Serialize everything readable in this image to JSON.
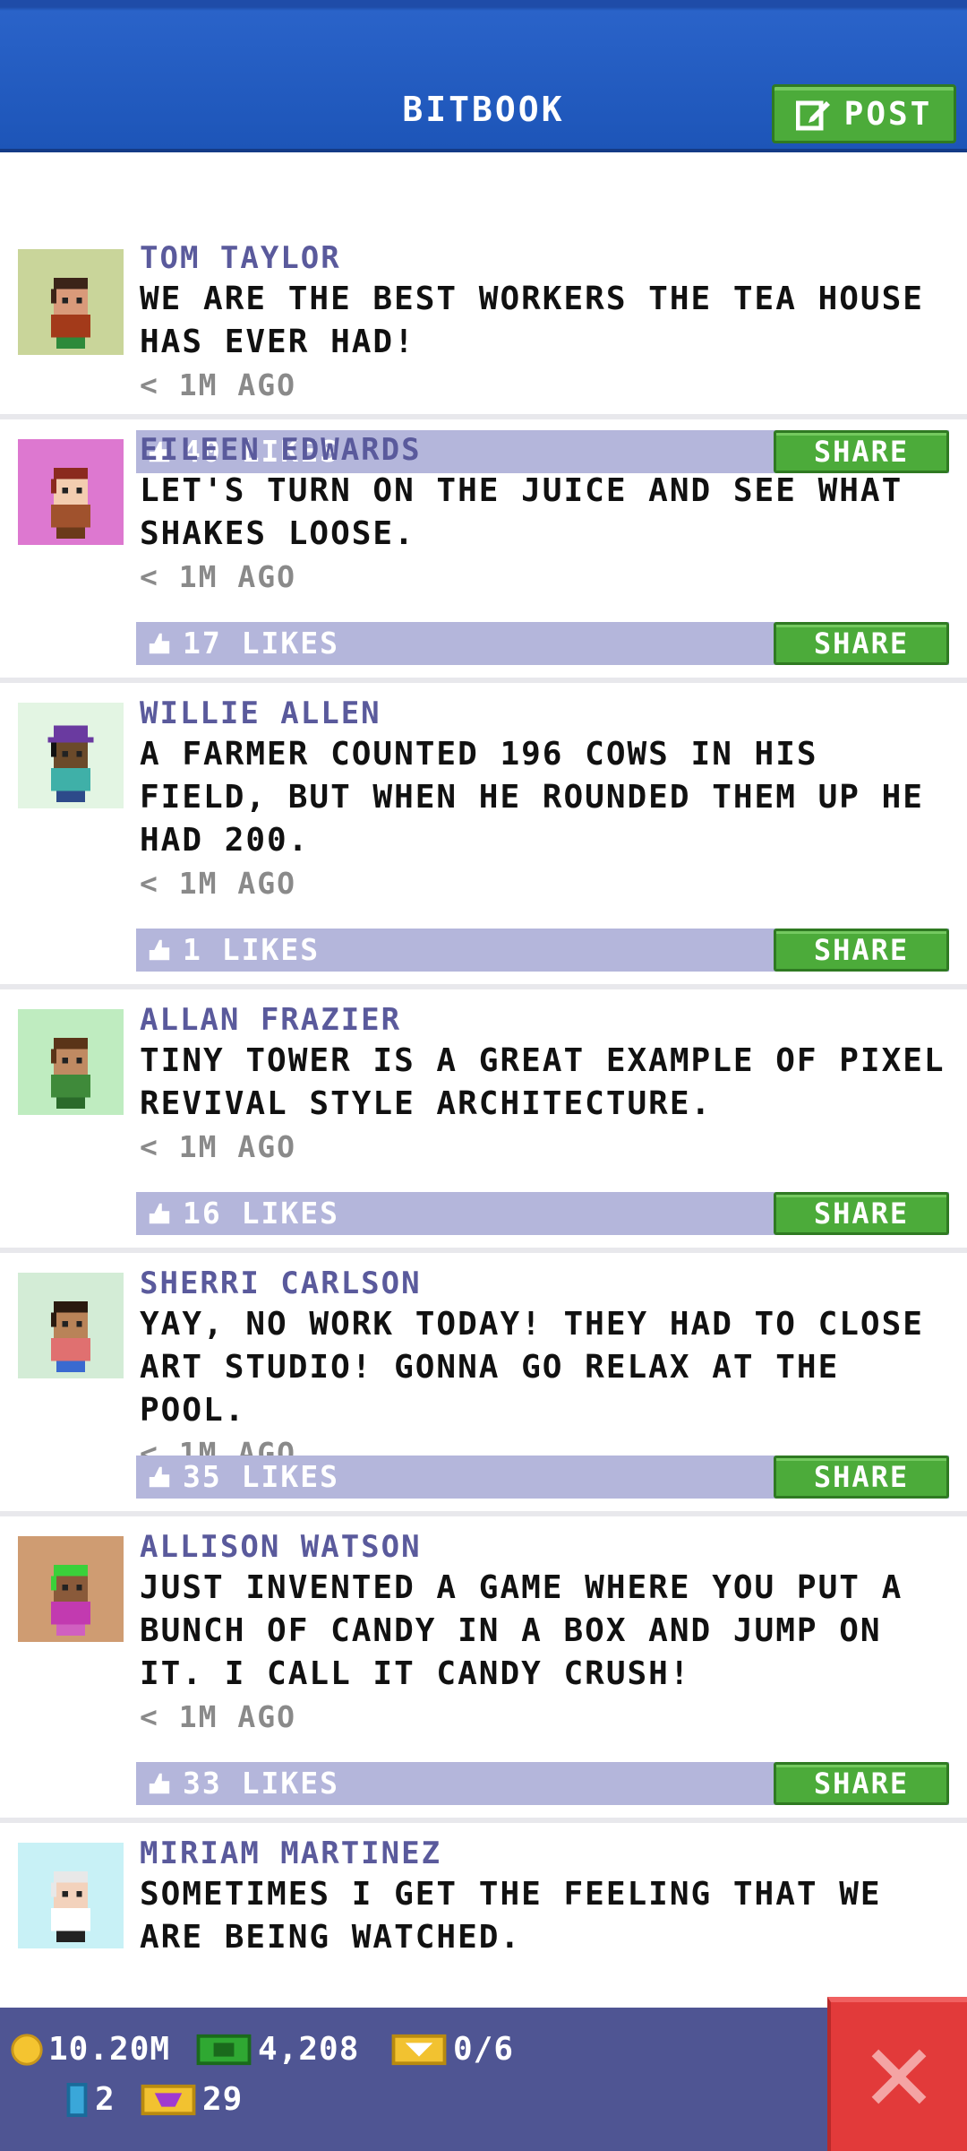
{
  "header": {
    "title": "BITBOOK",
    "post_label": "POST"
  },
  "posts": [
    {
      "name": "TOM TAYLOR",
      "message": "WE ARE THE BEST WORKERS THE TEA HOUSE HAS EVER HAD!",
      "time": "< 1M AGO",
      "likes": "40 LIKES",
      "share": "SHARE",
      "avatar_bg": "#c9d59a",
      "skin": "#d99a7a",
      "hair": "#3b2418",
      "shirt": "#a33a1a",
      "pants": "#2d8a3a",
      "hat": ""
    },
    {
      "name": "EILEEN EDWARDS",
      "message": "LET'S TURN ON THE JUICE AND SEE WHAT SHAKES LOOSE.",
      "time": "< 1M AGO",
      "likes": "17 LIKES",
      "share": "SHARE",
      "avatar_bg": "#dd78d0",
      "skin": "#f3cdb0",
      "hair": "#8b2a1e",
      "shirt": "#a0522d",
      "pants": "#6b3a1a",
      "hat": ""
    },
    {
      "name": "WILLIE ALLEN",
      "message": "A FARMER COUNTED 196 COWS IN HIS FIELD, BUT WHEN HE ROUNDED THEM UP HE HAD 200.",
      "time": "< 1M AGO",
      "likes": "1 LIKES",
      "share": "SHARE",
      "avatar_bg": "#e3f5e3",
      "skin": "#6b4a2a",
      "hair": "#111111",
      "shirt": "#3fb0a8",
      "pants": "#2d4a8a",
      "hat": "#6a3aa0"
    },
    {
      "name": "ALLAN FRAZIER",
      "message": "TINY TOWER IS A GREAT EXAMPLE OF PIXEL REVIVAL STYLE ARCHITECTURE.",
      "time": "< 1M AGO",
      "likes": "16 LIKES",
      "share": "SHARE",
      "avatar_bg": "#bfecc0",
      "skin": "#c08a62",
      "hair": "#5a3418",
      "shirt": "#3f8a3a",
      "pants": "#2a6a2a",
      "hat": ""
    },
    {
      "name": "SHERRI CARLSON",
      "message": "YAY, NO WORK TODAY! THEY HAD TO CLOSE ART STUDIO! GONNA GO RELAX AT THE POOL.",
      "time": "< 1M AGO",
      "likes": "35 LIKES",
      "share": "SHARE",
      "avatar_bg": "#d3ecd6",
      "skin": "#b98358",
      "hair": "#2a1a10",
      "shirt": "#e07070",
      "pants": "#3a6ad0",
      "hat": ""
    },
    {
      "name": "ALLISON WATSON",
      "message": "JUST INVENTED A GAME WHERE YOU PUT A BUNCH OF CANDY IN A BOX AND JUMP ON IT. I CALL IT CANDY CRUSH!",
      "time": "< 1M AGO",
      "likes": "33 LIKES",
      "share": "SHARE",
      "avatar_bg": "#cf9c72",
      "skin": "#8a5a3a",
      "hair": "#3ad13a",
      "shirt": "#c23ab0",
      "pants": "#d060c0",
      "hat": ""
    },
    {
      "name": "MIRIAM MARTINEZ",
      "message": "SOMETIMES I GET THE FEELING THAT WE ARE BEING WATCHED.",
      "time": "",
      "likes": "",
      "share": "",
      "avatar_bg": "#c8f1f6",
      "skin": "#f3d2bc",
      "hair": "#e8e8e8",
      "shirt": "#ffffff",
      "pants": "#222222",
      "hat": ""
    }
  ],
  "stats": {
    "coins": "10.20M",
    "bux": "4,208",
    "tickets": "0/6",
    "keys": "2",
    "gems": "29"
  },
  "colors": {
    "accent_green": "#4cab3a",
    "header_blue": "#1d55b8",
    "likes_bar": "#b4b6db",
    "bottom_bar": "#4f5593",
    "close_red": "#e23a3a"
  },
  "icons": {
    "post": "edit-icon",
    "like": "like-icon",
    "coin": "coin-icon",
    "bux": "bux-icon",
    "ticket": "ticket-icon",
    "key": "key-icon",
    "gem": "gem-icon",
    "close": "close-icon"
  }
}
